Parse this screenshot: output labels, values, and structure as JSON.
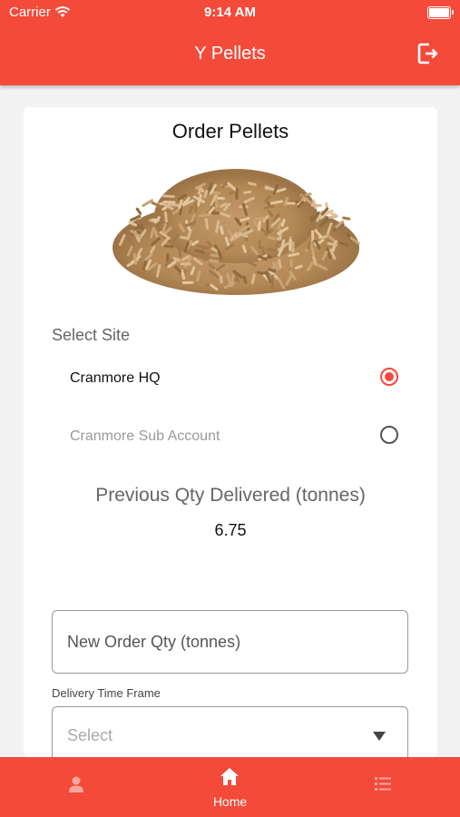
{
  "status_bar": {
    "carrier": "Carrier",
    "time": "9:14 AM"
  },
  "header": {
    "title": "Y Pellets",
    "logout_icon": "logout-icon"
  },
  "card": {
    "title": "Order Pellets",
    "image": "wood-pellets-image",
    "select_site_label": "Select Site",
    "sites": [
      {
        "label": "Cranmore HQ",
        "selected": true
      },
      {
        "label": "Cranmore Sub Account",
        "selected": false
      }
    ],
    "previous_qty_label": "Previous Qty Delivered (tonnes)",
    "previous_qty_value": "6.75",
    "new_order_placeholder": "New Order Qty (tonnes)",
    "delivery_label": "Delivery Time Frame",
    "delivery_value": "Select"
  },
  "tabbar": {
    "tabs": [
      {
        "icon": "person-icon",
        "label": ""
      },
      {
        "icon": "home-icon",
        "label": "Home"
      },
      {
        "icon": "list-icon",
        "label": ""
      }
    ]
  },
  "colors": {
    "accent": "#f44a3a",
    "background": "#f2f2f2"
  }
}
